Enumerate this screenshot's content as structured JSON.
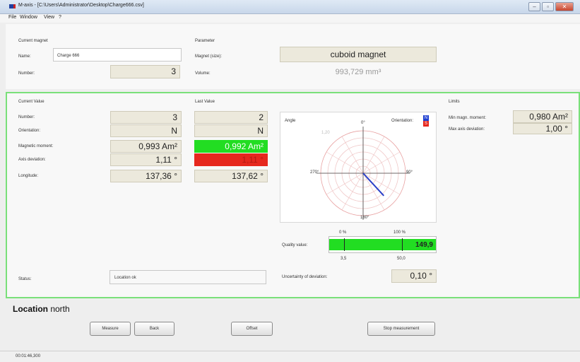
{
  "window": {
    "title": "M-axis - [C:\\Users\\Administrator\\Desktop\\Charge666.csv]"
  },
  "menu": [
    "File",
    "Window",
    "View",
    "?"
  ],
  "current_magnet": {
    "heading": "Current magnet",
    "name_label": "Name:",
    "name_value": "Charge 666",
    "number_label": "Number:",
    "number_value": "3"
  },
  "parameter": {
    "heading": "Parameter",
    "magnet_label": "Magnet (size):",
    "magnet_value": "cuboid magnet",
    "volume_label": "Volume:",
    "volume_value": "993,729 mm³"
  },
  "current_value": {
    "heading": "Current Value"
  },
  "last_value": {
    "heading": "Last Value"
  },
  "rows": [
    {
      "label": "Number:",
      "current": "3",
      "last": "2"
    },
    {
      "label": "Orientation:",
      "current": "N",
      "last": "N"
    },
    {
      "label": "Magnetic moment:",
      "current": "0,993 Am²",
      "last": "0,992 Am²",
      "last_color": "#22dd22"
    },
    {
      "label": "Axis deviation:",
      "current": "1,11 °",
      "last": "1,11 °",
      "last_color": "#e6281e"
    },
    {
      "label": "Longitude:",
      "current": "137,36 °",
      "last": "137,62 °"
    }
  ],
  "polar": {
    "angle_label": "Angle",
    "orientation_label": "Orientation:",
    "n_label": "N",
    "s_label": "S",
    "ticks": {
      "top": "0°",
      "right": "90°",
      "bottom": "180°",
      "left": "270°"
    },
    "ring_label": "1,20",
    "vector_angle_deg": 137.36,
    "vector_magnitude": 0.72,
    "colors": {
      "n": "#1f3fd0",
      "s": "#e6281e",
      "vector": "#2a40c8"
    }
  },
  "quality": {
    "label": "Quality value:",
    "tick_top_left": "0 %",
    "tick_top_right": "100 %",
    "tick_bottom_left": "3,5",
    "tick_bottom_right": "50,0",
    "value": "149,9",
    "fill_color": "#22dd22"
  },
  "uncertainty": {
    "label": "Uncertainty of deviation:",
    "value": "0,10 °"
  },
  "status": {
    "label": "Status:",
    "value": "Location ok"
  },
  "limits": {
    "heading": "Limits",
    "min_label": "Min magn. moment:",
    "min_value": "0,980 Am²",
    "max_label": "Max axis deviation:",
    "max_value": "1,00 °"
  },
  "location": {
    "bold": "Location",
    "rest": " north"
  },
  "buttons": {
    "measure": "Measure",
    "back": "Back",
    "offset": "Offset",
    "stop": "Stop measurement"
  },
  "statusbar": {
    "time": "00:01:46,300"
  }
}
